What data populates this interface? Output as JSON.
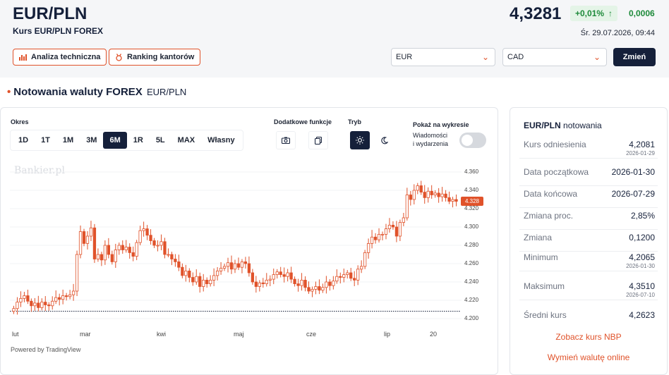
{
  "header": {
    "title": "EUR/PLN",
    "subtitle": "Kurs EUR/PLN FOREX",
    "price": "4,3281",
    "change_pct": "+0,01%",
    "change_abs": "0,0006",
    "datetime": "Śr. 29.07.2026, 09:44",
    "tech_analysis_label": "Analiza techniczna",
    "ranking_label": "Ranking kantorów",
    "from_currency": "EUR",
    "to_currency": "CAD",
    "change_button": "Zmień"
  },
  "section": {
    "title": "Notowania waluty FOREX",
    "subtitle": "EUR/PLN"
  },
  "chart_controls": {
    "period_label": "Okres",
    "periods": [
      "1D",
      "1T",
      "1M",
      "3M",
      "6M",
      "1R",
      "5L",
      "MAX",
      "Własny"
    ],
    "active_period": "6M",
    "extra_label": "Dodatkowe funkcje",
    "mode_label": "Tryb",
    "show_label": "Pokaż na wykresie",
    "news_label_1": "Wiadomości",
    "news_label_2": "i wydarzenia",
    "watermark": "Bankier.pl",
    "powered": "Powered by TradingView",
    "accent": "#e0522a"
  },
  "chart_data": {
    "type": "candlestick",
    "x_labels": [
      "lut",
      "mar",
      "kwi",
      "maj",
      "cze",
      "lip",
      "20"
    ],
    "y_ticks": [
      "4.360",
      "4.340",
      "4.320",
      "4.300",
      "4.280",
      "4.260",
      "4.240",
      "4.220",
      "4.200"
    ],
    "ylim": [
      4.2,
      4.36
    ],
    "last_price": "4.328",
    "reference_line": 4.2081,
    "closes": [
      4.211,
      4.218,
      4.222,
      4.225,
      4.219,
      4.214,
      4.217,
      4.212,
      4.218,
      4.215,
      4.214,
      4.219,
      4.223,
      4.221,
      4.225,
      4.224,
      4.226,
      4.23,
      4.27,
      4.295,
      4.282,
      4.29,
      4.299,
      4.265,
      4.27,
      4.264,
      4.28,
      4.27,
      4.262,
      4.275,
      4.28,
      4.275,
      4.278,
      4.272,
      4.268,
      4.283,
      4.296,
      4.298,
      4.291,
      4.285,
      4.28,
      4.28,
      4.284,
      4.27,
      4.27,
      4.265,
      4.262,
      4.256,
      4.247,
      4.252,
      4.245,
      4.24,
      4.246,
      4.235,
      4.242,
      4.238,
      4.242,
      4.247,
      4.252,
      4.255,
      4.257,
      4.261,
      4.254,
      4.26,
      4.256,
      4.262,
      4.26,
      4.25,
      4.24,
      4.235,
      4.239,
      4.238,
      4.242,
      4.243,
      4.248,
      4.251,
      4.248,
      4.246,
      4.25,
      4.243,
      4.238,
      4.236,
      4.242,
      4.234,
      4.23,
      4.232,
      4.235,
      4.231,
      4.234,
      4.24,
      4.236,
      4.241,
      4.246,
      4.245,
      4.248,
      4.25,
      4.244,
      4.242,
      4.254,
      4.257,
      4.272,
      4.282,
      4.289,
      4.286,
      4.292,
      4.292,
      4.298,
      4.302,
      4.3,
      4.29,
      4.305,
      4.31,
      4.335,
      4.33,
      4.34,
      4.345,
      4.338,
      4.332,
      4.339,
      4.335,
      4.337,
      4.333,
      4.336,
      4.332,
      4.328,
      4.33,
      4.328
    ]
  },
  "side": {
    "title_pair": "EUR/PLN",
    "title_rest": "notowania",
    "rows": [
      {
        "label": "Kurs odniesienia",
        "value": "4,2081",
        "date": "2026-01-29"
      },
      {
        "label": "Data początkowa",
        "value": "2026-01-30"
      },
      {
        "label": "Data końcowa",
        "value": "2026-07-29"
      },
      {
        "label": "Zmiana proc.",
        "value": "2,85%"
      },
      {
        "label": "Zmiana",
        "value": "0,1200"
      },
      {
        "label": "Minimum",
        "value": "4,2065",
        "date": "2026-01-30"
      },
      {
        "label": "Maksimum",
        "value": "4,3510",
        "date": "2026-07-10"
      },
      {
        "label": "Średni kurs",
        "value": "4,2623"
      }
    ],
    "link_nbp": "Zobacz kurs NBP",
    "link_exchange": "Wymień walutę online"
  }
}
